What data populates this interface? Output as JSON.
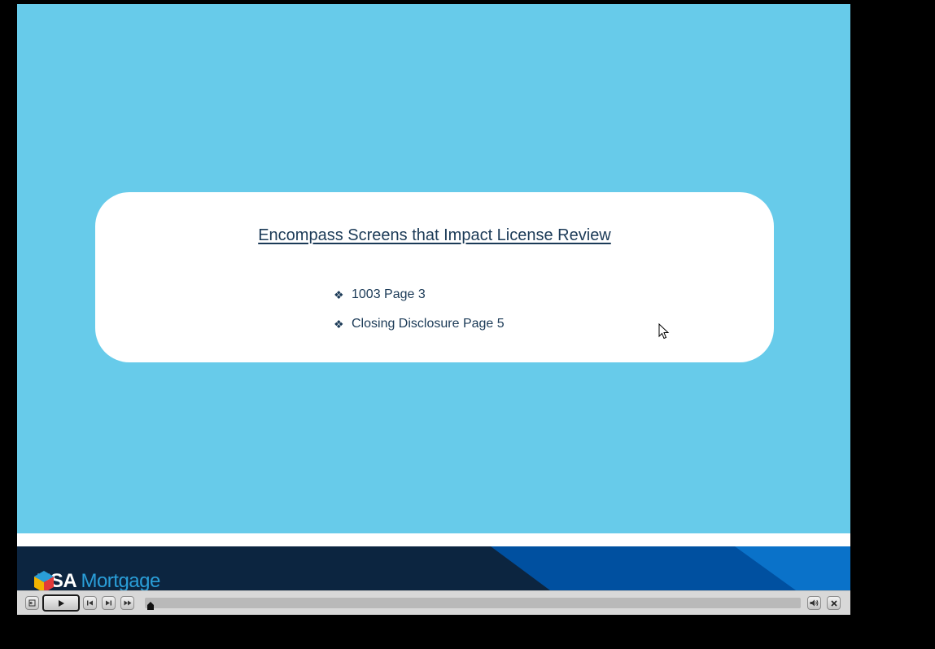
{
  "slide": {
    "title": "Encompass Screens that Impact License Review",
    "bullets": [
      {
        "text": "1003 Page 3",
        "glyph": "❖"
      },
      {
        "text": "Closing Disclosure Page 5",
        "glyph": "❖"
      }
    ]
  },
  "footer": {
    "brand_primary": "USA",
    "brand_secondary": "Mortgage"
  },
  "player": {
    "progress_fraction": 0.0,
    "buttons": [
      {
        "name": "exit-icon"
      },
      {
        "name": "play-icon"
      },
      {
        "name": "previous-slide-icon"
      },
      {
        "name": "next-slide-icon"
      },
      {
        "name": "fast-forward-icon"
      },
      {
        "name": "volume-icon"
      },
      {
        "name": "close-icon"
      }
    ]
  },
  "colors": {
    "slide_background": "#67cbea",
    "card_background": "#ffffff",
    "text": "#1b3a57",
    "footer_navy": "#0c2540",
    "footer_blue": "#0050a0",
    "footer_light_blue": "#0a72c9",
    "player_bar": "#d8d8d8"
  }
}
